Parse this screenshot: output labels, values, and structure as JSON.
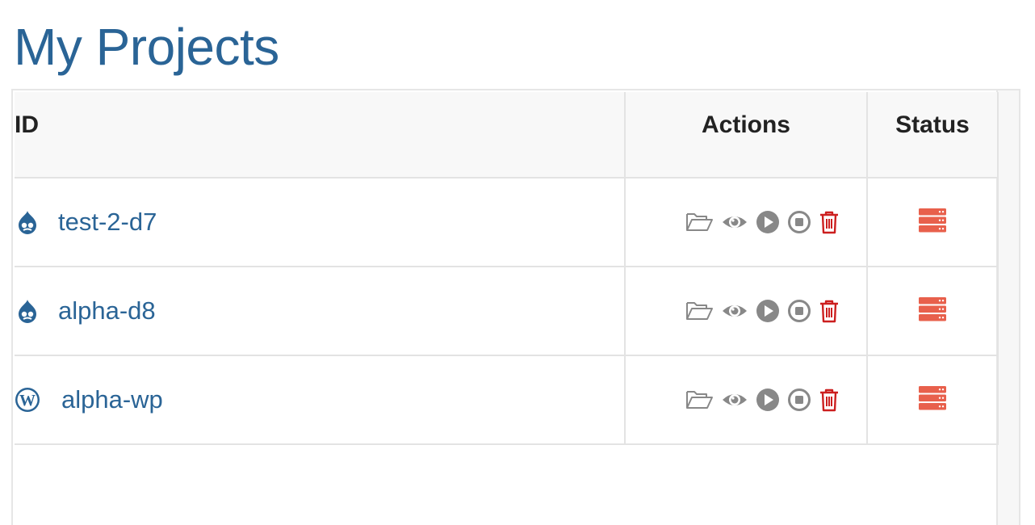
{
  "page": {
    "title": "My Projects"
  },
  "table": {
    "headers": {
      "id": "ID",
      "actions": "Actions",
      "status": "Status"
    },
    "rows": [
      {
        "name": "test-2-d7",
        "platform_icon": "drupal-icon",
        "status_icon": "server-stopped-icon"
      },
      {
        "name": "alpha-d8",
        "platform_icon": "drupal-icon",
        "status_icon": "server-stopped-icon"
      },
      {
        "name": "alpha-wp",
        "platform_icon": "wordpress-icon",
        "status_icon": "server-stopped-icon"
      }
    ],
    "action_icons": [
      "folder-open-icon",
      "eye-icon",
      "play-icon",
      "stop-icon",
      "trash-icon"
    ]
  },
  "colors": {
    "link": "#2a6496",
    "action_gray": "#888888",
    "delete_red": "#cc1f1f",
    "status_red": "#e8604c"
  }
}
